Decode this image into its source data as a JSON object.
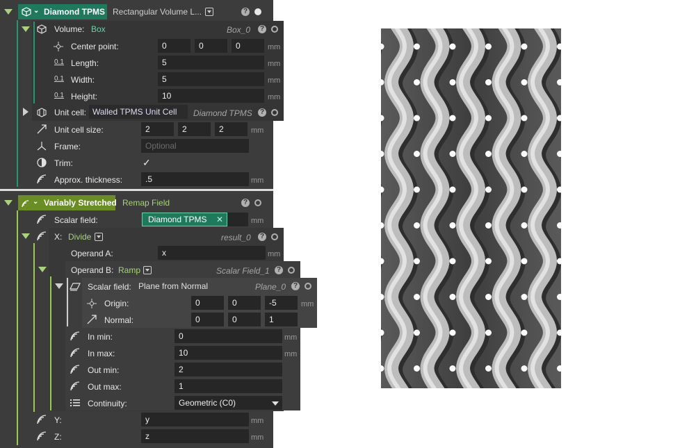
{
  "diamond": {
    "title": "Diamond TPMS",
    "type_label": "Rectangular Volume L...",
    "volume": {
      "label": "Volume:",
      "type": "Box",
      "ref": "Box_0",
      "center_label": "Center point:",
      "center": [
        "0",
        "0",
        "0"
      ],
      "length_label": "Length:",
      "length": "5",
      "width_label": "Width:",
      "width": "5",
      "height_label": "Height:",
      "height": "10",
      "unit": "mm"
    },
    "unit_cell": {
      "label": "Unit cell:",
      "type": "Walled TPMS Unit Cell",
      "ref": "Diamond TPMS"
    },
    "unit_cell_size": {
      "label": "Unit cell size:",
      "values": [
        "2",
        "2",
        "2"
      ],
      "unit": "mm"
    },
    "frame": {
      "label": "Frame:",
      "placeholder": "Optional"
    },
    "trim": {
      "label": "Trim:",
      "checked": "✓"
    },
    "approx": {
      "label": "Approx. thickness:",
      "value": ".5",
      "unit": "mm"
    }
  },
  "variably": {
    "title": "Variably Stretched",
    "type_label": "Remap Field",
    "scalar_field": {
      "label": "Scalar field:",
      "value": "Diamond TPMS",
      "clear": "✕",
      "unit": "mm"
    },
    "x": {
      "label": "X:",
      "type": "Divide",
      "ref": "result_0",
      "operand_a": {
        "label": "Operand A:",
        "value": "x",
        "unit": "mm"
      },
      "operand_b": {
        "label": "Operand B:",
        "type": "Ramp",
        "ref": "Scalar Field_1",
        "scalar": {
          "label": "Scalar field:",
          "type": "Plane from Normal",
          "ref": "Plane_0",
          "origin_label": "Origin:",
          "origin": [
            "0",
            "0",
            "-5"
          ],
          "normal_label": "Normal:",
          "normal": [
            "0",
            "0",
            "1"
          ],
          "unit": "mm"
        },
        "in_min": {
          "label": "In min:",
          "value": "0",
          "unit": "mm"
        },
        "in_max": {
          "label": "In max:",
          "value": "10",
          "unit": "mm"
        },
        "out_min": {
          "label": "Out min:",
          "value": "2"
        },
        "out_max": {
          "label": "Out max:",
          "value": "1"
        },
        "continuity": {
          "label": "Continuity:",
          "value": "Geometric (C0)"
        }
      }
    },
    "y": {
      "label": "Y:",
      "value": "y",
      "unit": "mm"
    },
    "z": {
      "label": "Z:",
      "value": "z",
      "unit": "mm"
    }
  },
  "colors": {
    "accent_teal": "#1f7a5d",
    "accent_olive": "#6a8d25",
    "text_green": "#a8d27c"
  },
  "icons": [
    "lattice-icon",
    "box-icon",
    "point-icon",
    "decimal-icon",
    "cube-cell-icon",
    "arrow-diagonal-icon",
    "axes-icon",
    "half-circle-icon",
    "arc-waves-icon",
    "list-icon",
    "plane-icon",
    "help-icon",
    "eye-dot-icon"
  ]
}
